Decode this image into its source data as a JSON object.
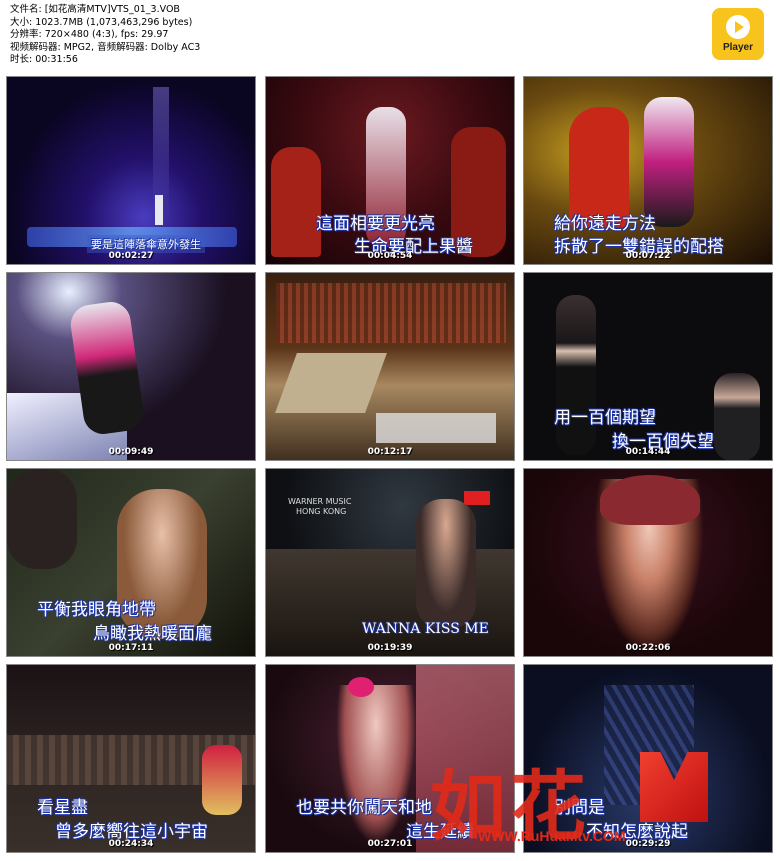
{
  "file_info": {
    "filename": "文件名: [如花高清MTV]VTS_01_3.VOB",
    "size": "大小: 1023.7MB (1,073,463,296 bytes)",
    "resolution": "分辨率: 720×480 (4:3), fps: 29.97",
    "codecs": "视频解码器: MPG2, 音频解码器: Dolby AC3",
    "duration": "时长: 00:31:56"
  },
  "player_logo": {
    "label": "Player",
    "icon": "play-icon",
    "color": "#f7c31c"
  },
  "thumbnails": [
    {
      "time": "00:02:27",
      "subtitles": [
        "要是這陣落傘意外發生"
      ]
    },
    {
      "time": "00:04:54",
      "subtitles": [
        "這面相要更光亮",
        "生命要配上果醬"
      ]
    },
    {
      "time": "00:07:22",
      "subtitles": [
        "給你遠走方法",
        "拆散了一雙錯誤的配搭"
      ]
    },
    {
      "time": "00:09:49",
      "subtitles": []
    },
    {
      "time": "00:12:17",
      "subtitles": []
    },
    {
      "time": "00:14:44",
      "subtitles": [
        "用一百個期望",
        "換一百個失望"
      ]
    },
    {
      "time": "00:17:11",
      "subtitles": [
        "平衡我眼角地帶",
        "鳥瞰我熱暖面龐"
      ]
    },
    {
      "time": "00:19:39",
      "subtitles": [
        "WANNA KISS ME"
      ],
      "overlay": [
        "WARNER MUSIC",
        "HONG KONG"
      ]
    },
    {
      "time": "00:22:06",
      "subtitles": []
    },
    {
      "time": "00:24:34",
      "subtitles": [
        "看星盡",
        "曾多麼嚮往這小宇宙"
      ]
    },
    {
      "time": "00:27:01",
      "subtitles": [
        "也要共你闖天和地",
        "這生延續"
      ]
    },
    {
      "time": "00:29:29",
      "subtitles": [
        "別問是",
        "不知怎麼說起"
      ]
    }
  ],
  "watermark": {
    "text": "如花",
    "url": "WWW.RuHuaMtv.COM",
    "color": "#e12a1a"
  }
}
